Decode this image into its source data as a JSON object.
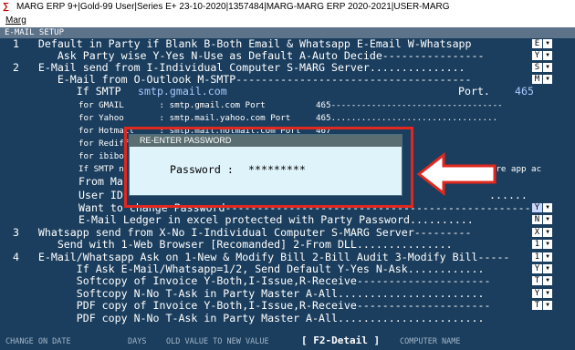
{
  "window": {
    "title": "MARG ERP 9+|Gold-99 User|Series E+ 23-10-2020|1357484|MARG-MARG ERP 2020-2021|USER-MARG",
    "menu": "Marg"
  },
  "screen_header": "E-MAIL SETUP",
  "lines": [
    "  1   Default in Party if Blank B-Both Email & Whatsapp E-Email W-Whatsapp",
    "         Ask Party wise Y-Yes N-Use as Default A-Auto Decide----------------",
    "  2   E-Mail send from I-Individual Computer S-MARG Server...............",
    "         E-Mail from O-Outlook M-SMTP-------------------------------------",
    "            If SMTP ",
    "smtp.gmail.com",
    "Port.",
    "465",
    "for GMAIL       : smtp.gmail.com Port          465----------------------------------",
    "for Yahoo       : smtp.mail.yahoo.com Port     465.................................",
    "for Hotmail     : smtp.mail.hotmail.com Port   467",
    "for Rediff",
    "for ibibo",
    "If SMTP n",
    "\"Less secure app ac",
    "From Ma",
    "User ID",
    "......",
    "Want to change Password------------------------------------------------",
    "E-Mail Ledger in excel protected with Party Password..........",
    "  3   Whatsapp send from X-No I-Individual Computer S-MARG Server---------",
    "         Send with 1-Web Browser [Recomanded] 2-From DLL...............",
    "  4   E-Mail/Whatsapp Ask on 1-New & Modify Bill 2-Bill Audit 3-Modify Bill-----",
    "            If Ask E-Mail/Whatsapp=1/2, Send Default Y-Yes N-Ask............",
    "            Softcopy of Invoice Y-Both,I-Issue,R-Receive---------------------",
    "            Softcopy N-No T-Ask in Party Master A-All.......................",
    "            PDF copy of Invoice Y-Both,I-Issue,R-Receive---------------------",
    "            PDF copy N-No T-Ask in Party Master A-All......................."
  ],
  "options": [
    "E",
    "Y",
    "S",
    "M",
    "Y",
    "N",
    "X",
    "1",
    "1",
    "Y",
    "T",
    "Y",
    "T"
  ],
  "dialog": {
    "title": "RE-ENTER PASSWORD",
    "label": "Password :",
    "value": "*********"
  },
  "status": {
    "change_on_date": "CHANGE ON DATE",
    "days": "DAYS",
    "old_to_new": "OLD VALUE TO NEW VALUE",
    "f2": "[ F2-Detail ]",
    "computer_name": "COMPUTER NAME"
  },
  "colors": {
    "screen_bg": "#1b3e5e",
    "highlight": "#e0281f",
    "dialog_bg": "#dff3fb"
  }
}
